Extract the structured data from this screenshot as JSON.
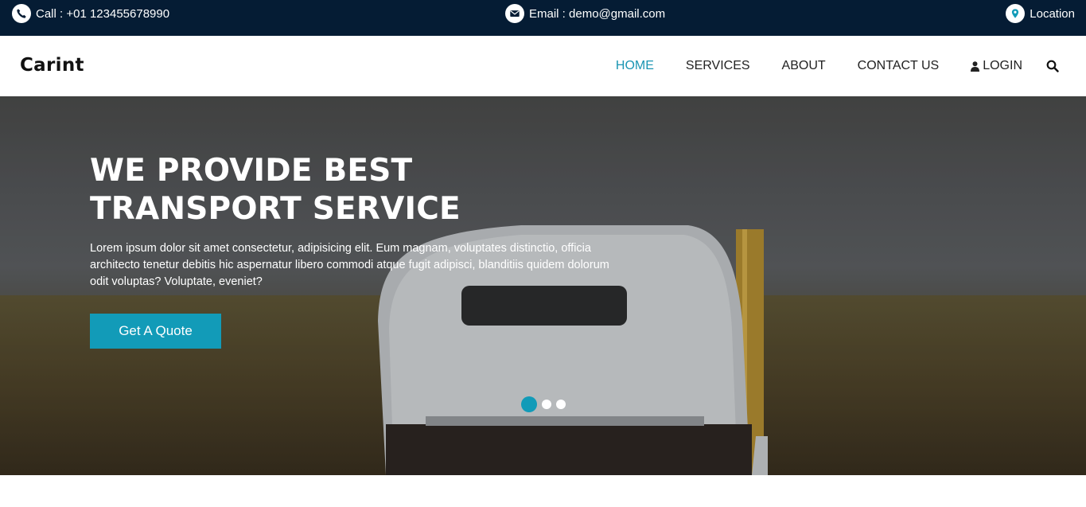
{
  "topbar": {
    "call": {
      "icon": "phone-icon",
      "text": "Call : +01 123455678990"
    },
    "email": {
      "icon": "envelope-icon",
      "text": "Email : demo@gmail.com"
    },
    "location": {
      "icon": "map-pin-icon",
      "text": "Location"
    }
  },
  "header": {
    "brand": "Carint",
    "nav": [
      {
        "label": "HOME",
        "active": true
      },
      {
        "label": "SERVICES",
        "active": false
      },
      {
        "label": "ABOUT",
        "active": false
      },
      {
        "label": "CONTACT US",
        "active": false
      },
      {
        "label": "LOGIN",
        "icon": "user-icon",
        "active": false
      }
    ],
    "search_icon": "search-icon"
  },
  "hero": {
    "title_line1": "WE PROVIDE BEST",
    "title_line2": "TRANSPORT SERVICE",
    "description": "Lorem ipsum dolor sit amet consectetur, adipisicing elit. Eum magnam, voluptates distinctio, officia architecto tenetur debitis hic aspernatur libero commodi atque fugit adipisci, blanditiis quidem dolorum odit voluptas? Voluptate, eveniet?",
    "cta_label": "Get A Quote",
    "slides": {
      "count": 3,
      "active_index": 0
    }
  },
  "colors": {
    "topbar_bg": "#051c34",
    "accent": "#129bb8",
    "nav_active": "#1a95b3"
  }
}
